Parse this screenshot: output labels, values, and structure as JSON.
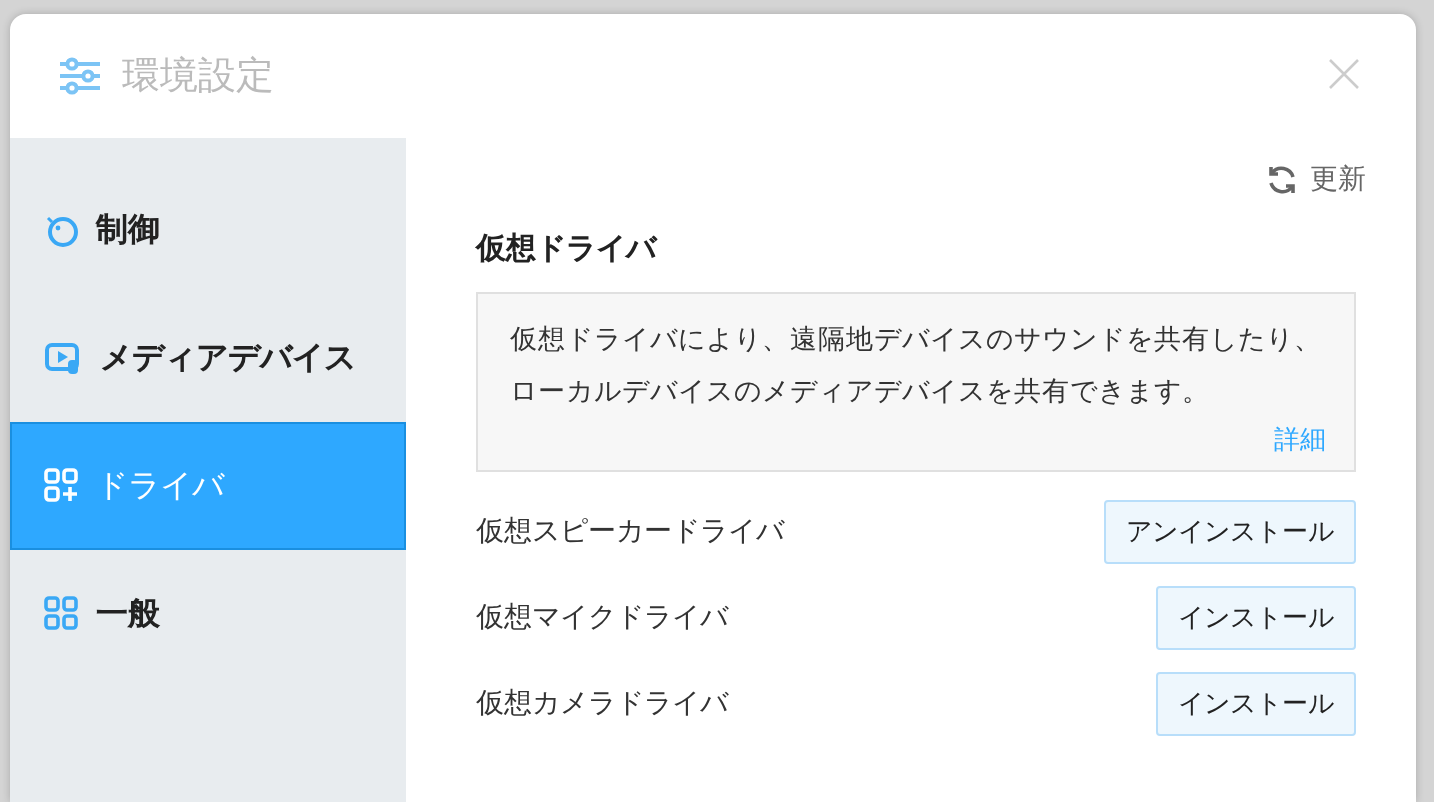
{
  "window": {
    "title": "環境設定"
  },
  "sidebar": {
    "items": [
      {
        "label": "制御",
        "kind": "control",
        "selected": false
      },
      {
        "label": "メディアデバイス",
        "kind": "media",
        "selected": false
      },
      {
        "label": "ドライバ",
        "kind": "driver",
        "selected": true
      },
      {
        "label": "一般",
        "kind": "general",
        "selected": false
      }
    ]
  },
  "refresh": {
    "label": "更新"
  },
  "section": {
    "title": "仮想ドライバ",
    "description": "仮想ドライバにより、遠隔地デバイスのサウンドを共有したり、ローカルデバイスのメディアデバイスを共有できます。",
    "details_link": "詳細"
  },
  "drivers": [
    {
      "name": "仮想スピーカードライバ",
      "action": "アンインストール"
    },
    {
      "name": "仮想マイクドライバ",
      "action": "インストール"
    },
    {
      "name": "仮想カメラドライバ",
      "action": "インストール"
    }
  ]
}
